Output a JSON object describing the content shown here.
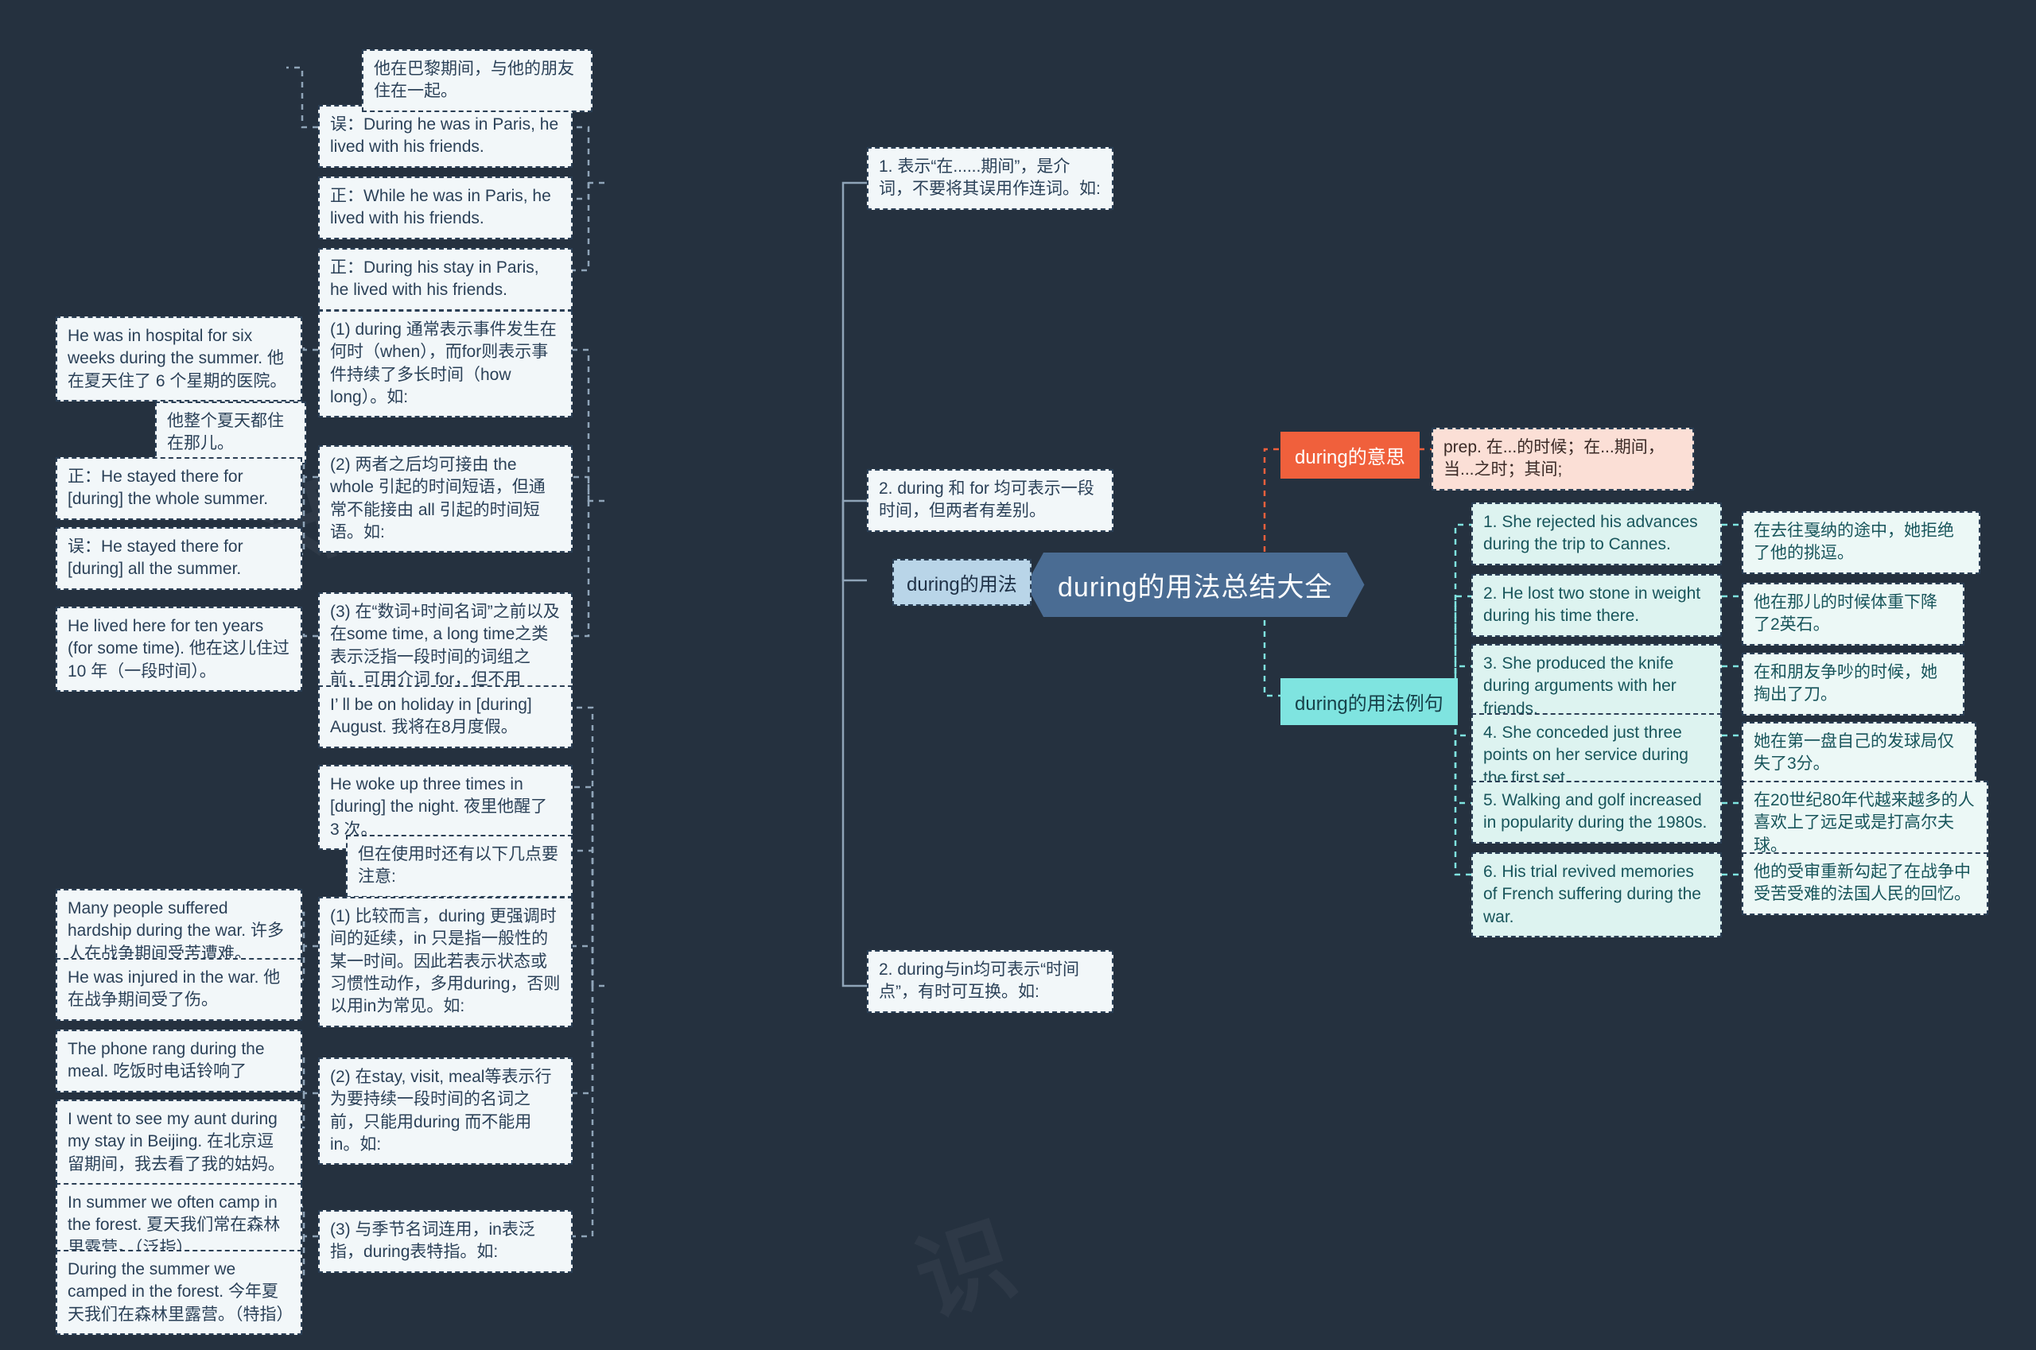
{
  "root": {
    "label": "during的用法总结大全"
  },
  "branches": {
    "usage": {
      "label": "during的用法"
    },
    "meaning": {
      "label": "during的意思"
    },
    "examples": {
      "label": "during的用法例句"
    }
  },
  "meaning_definition": "prep. 在...的时候；在...期间，当...之时；其间;",
  "example_sentences": [
    {
      "en": "1. She rejected his advances during the trip to Cannes.",
      "cn": "在去往戛纳的途中，她拒绝了他的挑逗。"
    },
    {
      "en": "2. He lost two stone in weight during his time there.",
      "cn": "他在那儿的时候体重下降了2英石。"
    },
    {
      "en": "3. She produced the knife during arguments with her friends.",
      "cn": "在和朋友争吵的时候，她掏出了刀。"
    },
    {
      "en": "4. She conceded just three points on her service during the first set.",
      "cn": "她在第一盘自己的发球局仅失了3分。"
    },
    {
      "en": "5. Walking and golf increased in popularity during the 1980s.",
      "cn": "在20世纪80年代越来越多的人喜欢上了远足或是打高尔夫球。"
    },
    {
      "en": "6. His trial revived memories of French suffering during the war.",
      "cn": "他的受审重新勾起了在战争中受苦受难的法国人民的回忆。"
    }
  ],
  "usage_sections": [
    {
      "label": "1. 表示“在......期间”，是介词，不要将其误用作连词。如:",
      "children": [
        {
          "label": "误：During he was in Paris, he lived with his friends.",
          "leaves": [
            "他在巴黎期间，与他的朋友住在一起。"
          ]
        },
        {
          "label": "正：While he was in Paris, he lived with his friends.",
          "leaves": []
        },
        {
          "label": "正：During his stay in Paris, he lived with his friends.",
          "leaves": []
        }
      ]
    },
    {
      "label": "2. during 和 for 均可表示一段时间，但两者有差别。",
      "children": [
        {
          "label": "(1) during 通常表示事件发生在何时（when），而for则表示事件持续了多长时间（how long）。如:",
          "leaves": [
            "He was in hospital for six weeks during the summer. 他在夏天住了 6 个星期的医院。"
          ]
        },
        {
          "label": "(2) 两者之后均可接由 the whole 引起的时间短语，但通常不能接由 all 引起的时间短语。如:",
          "leaves": [
            "他整个夏天都住在那儿。",
            "正：He stayed there for [during] the whole summer.",
            "误：He stayed there for [during] all the summer."
          ]
        },
        {
          "label": "(3) 在“数词+时间名词”之前以及在some time, a long time之类表示泛指一段时间的词组之前，可用介词 for，但不用 during。如:",
          "leaves": [
            "He lived here for ten years (for some time). 他在这儿住过 10 年（一段时间）。"
          ]
        }
      ]
    },
    {
      "label": "2. during与in均可表示“时间点”，有时可互换。如:",
      "children": [
        {
          "label": "I’ ll be on holiday in [during] August. 我将在8月度假。",
          "leaves": []
        },
        {
          "label": "He woke up three times in [during] the night. 夜里他醒了 3 次。",
          "leaves": []
        },
        {
          "label": "但在使用时还有以下几点要注意:",
          "leaves": []
        },
        {
          "label": "(1) 比较而言，during 更强调时间的延续，in 只是指一般性的某一时间。因此若表示状态或习惯性动作，多用during，否则以用in为常见。如:",
          "leaves": [
            "Many people suffered hardship during the war. 许多人在战争期间受苦遭难。",
            "He was injured in the war. 他在战争期间受了伤。"
          ]
        },
        {
          "label": "(2) 在stay, visit, meal等表示行为要持续一段时间的名词之前，只能用during 而不能用in。如:",
          "leaves": [
            "The phone rang during the meal. 吃饭时电话铃响了",
            "I went to see my aunt during my stay in Beijing. 在北京逗留期间，我去看了我的姑妈。"
          ]
        },
        {
          "label": "(3) 与季节名词连用，in表泛指，during表特指。如:",
          "leaves": [
            "In summer we often camp in the forest. 夏天我们常在森林里露营。（泛指）",
            "During the summer we camped in the forest. 今年夏天我们在森林里露营。（特指）"
          ]
        }
      ]
    }
  ],
  "colors": {
    "background": "#25313f",
    "root": "#4a6c93",
    "usage_chip": "#b9d5e8",
    "meaning_chip": "#f0603c",
    "examples_chip": "#7fe4e0",
    "node_bg": "#f2f7f9",
    "example_en_bg": "#ddf3f0"
  }
}
